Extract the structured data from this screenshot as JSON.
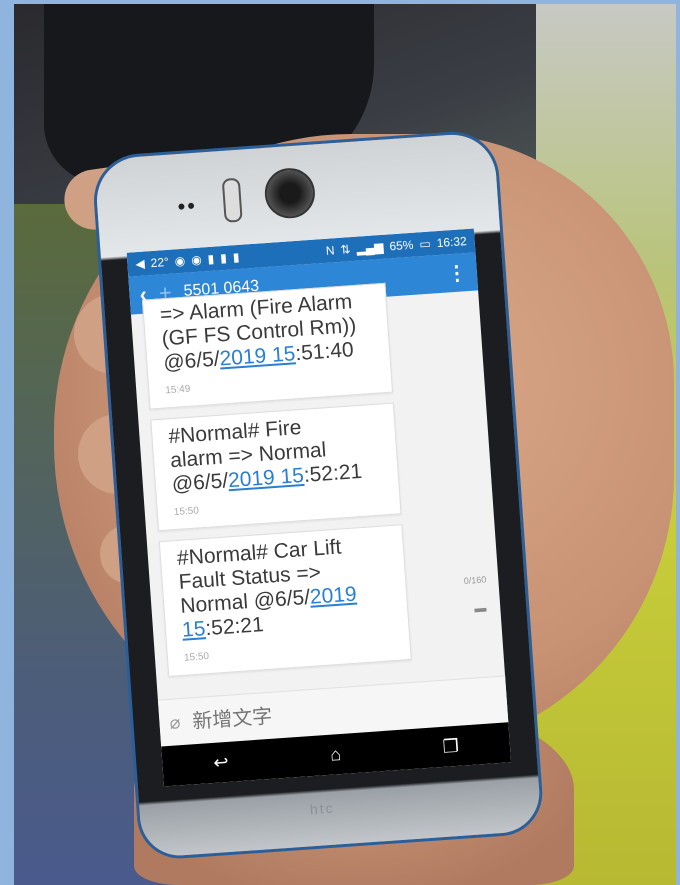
{
  "status_bar": {
    "temperature": "22°",
    "battery": "65%",
    "time": "16:32"
  },
  "app_bar": {
    "contact": "5501 0643",
    "back_icon": "chevron-left-icon",
    "add_icon": "plus-icon",
    "more_icon": "more-vertical-icon"
  },
  "messages": [
    {
      "line1": "=> Alarm (Fire Alarm",
      "line2": "(GF FS Control Rm))",
      "prefix": "@6/5/",
      "link": "2019 15",
      "suffix": ":51:40",
      "time": "15:49"
    },
    {
      "line1": "#Normal# Fire",
      "line2": "alarm => Normal",
      "prefix": "@6/5/",
      "link": "2019 15",
      "suffix": ":52:21",
      "time": "15:50"
    },
    {
      "line1": "#Normal# Car Lift",
      "line2": "Fault Status =>",
      "line3_prefix": "Normal  @6/5/",
      "line3_link": "2019",
      "line4_link": "15",
      "line4_suffix": ":52:21",
      "time": "15:50"
    }
  ],
  "counter": "0/160",
  "compose": {
    "placeholder": "新增文字"
  },
  "brand": "htc",
  "colors": {
    "status_bar": "#1e6fba",
    "app_bar": "#2d86d6",
    "link": "#2a7fd4"
  }
}
